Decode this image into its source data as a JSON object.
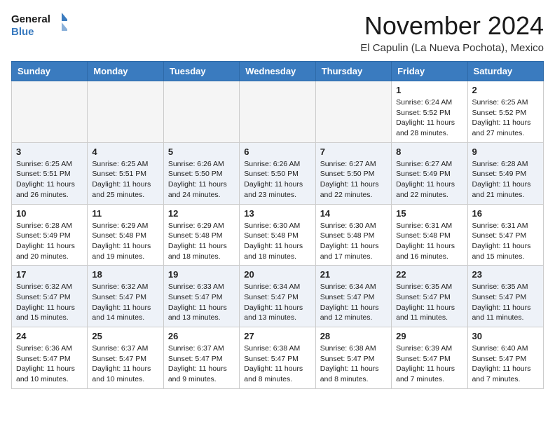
{
  "header": {
    "logo_line1": "General",
    "logo_line2": "Blue",
    "month": "November 2024",
    "location": "El Capulin (La Nueva Pochota), Mexico"
  },
  "weekdays": [
    "Sunday",
    "Monday",
    "Tuesday",
    "Wednesday",
    "Thursday",
    "Friday",
    "Saturday"
  ],
  "weeks": [
    [
      {
        "day": "",
        "empty": true
      },
      {
        "day": "",
        "empty": true
      },
      {
        "day": "",
        "empty": true
      },
      {
        "day": "",
        "empty": true
      },
      {
        "day": "",
        "empty": true
      },
      {
        "day": "1",
        "sunrise": "6:24 AM",
        "sunset": "5:52 PM",
        "daylight": "11 hours and 28 minutes."
      },
      {
        "day": "2",
        "sunrise": "6:25 AM",
        "sunset": "5:52 PM",
        "daylight": "11 hours and 27 minutes."
      }
    ],
    [
      {
        "day": "3",
        "sunrise": "6:25 AM",
        "sunset": "5:51 PM",
        "daylight": "11 hours and 26 minutes."
      },
      {
        "day": "4",
        "sunrise": "6:25 AM",
        "sunset": "5:51 PM",
        "daylight": "11 hours and 25 minutes."
      },
      {
        "day": "5",
        "sunrise": "6:26 AM",
        "sunset": "5:50 PM",
        "daylight": "11 hours and 24 minutes."
      },
      {
        "day": "6",
        "sunrise": "6:26 AM",
        "sunset": "5:50 PM",
        "daylight": "11 hours and 23 minutes."
      },
      {
        "day": "7",
        "sunrise": "6:27 AM",
        "sunset": "5:50 PM",
        "daylight": "11 hours and 22 minutes."
      },
      {
        "day": "8",
        "sunrise": "6:27 AM",
        "sunset": "5:49 PM",
        "daylight": "11 hours and 22 minutes."
      },
      {
        "day": "9",
        "sunrise": "6:28 AM",
        "sunset": "5:49 PM",
        "daylight": "11 hours and 21 minutes."
      }
    ],
    [
      {
        "day": "10",
        "sunrise": "6:28 AM",
        "sunset": "5:49 PM",
        "daylight": "11 hours and 20 minutes."
      },
      {
        "day": "11",
        "sunrise": "6:29 AM",
        "sunset": "5:48 PM",
        "daylight": "11 hours and 19 minutes."
      },
      {
        "day": "12",
        "sunrise": "6:29 AM",
        "sunset": "5:48 PM",
        "daylight": "11 hours and 18 minutes."
      },
      {
        "day": "13",
        "sunrise": "6:30 AM",
        "sunset": "5:48 PM",
        "daylight": "11 hours and 18 minutes."
      },
      {
        "day": "14",
        "sunrise": "6:30 AM",
        "sunset": "5:48 PM",
        "daylight": "11 hours and 17 minutes."
      },
      {
        "day": "15",
        "sunrise": "6:31 AM",
        "sunset": "5:48 PM",
        "daylight": "11 hours and 16 minutes."
      },
      {
        "day": "16",
        "sunrise": "6:31 AM",
        "sunset": "5:47 PM",
        "daylight": "11 hours and 15 minutes."
      }
    ],
    [
      {
        "day": "17",
        "sunrise": "6:32 AM",
        "sunset": "5:47 PM",
        "daylight": "11 hours and 15 minutes."
      },
      {
        "day": "18",
        "sunrise": "6:32 AM",
        "sunset": "5:47 PM",
        "daylight": "11 hours and 14 minutes."
      },
      {
        "day": "19",
        "sunrise": "6:33 AM",
        "sunset": "5:47 PM",
        "daylight": "11 hours and 13 minutes."
      },
      {
        "day": "20",
        "sunrise": "6:34 AM",
        "sunset": "5:47 PM",
        "daylight": "11 hours and 13 minutes."
      },
      {
        "day": "21",
        "sunrise": "6:34 AM",
        "sunset": "5:47 PM",
        "daylight": "11 hours and 12 minutes."
      },
      {
        "day": "22",
        "sunrise": "6:35 AM",
        "sunset": "5:47 PM",
        "daylight": "11 hours and 11 minutes."
      },
      {
        "day": "23",
        "sunrise": "6:35 AM",
        "sunset": "5:47 PM",
        "daylight": "11 hours and 11 minutes."
      }
    ],
    [
      {
        "day": "24",
        "sunrise": "6:36 AM",
        "sunset": "5:47 PM",
        "daylight": "11 hours and 10 minutes."
      },
      {
        "day": "25",
        "sunrise": "6:37 AM",
        "sunset": "5:47 PM",
        "daylight": "11 hours and 10 minutes."
      },
      {
        "day": "26",
        "sunrise": "6:37 AM",
        "sunset": "5:47 PM",
        "daylight": "11 hours and 9 minutes."
      },
      {
        "day": "27",
        "sunrise": "6:38 AM",
        "sunset": "5:47 PM",
        "daylight": "11 hours and 8 minutes."
      },
      {
        "day": "28",
        "sunrise": "6:38 AM",
        "sunset": "5:47 PM",
        "daylight": "11 hours and 8 minutes."
      },
      {
        "day": "29",
        "sunrise": "6:39 AM",
        "sunset": "5:47 PM",
        "daylight": "11 hours and 7 minutes."
      },
      {
        "day": "30",
        "sunrise": "6:40 AM",
        "sunset": "5:47 PM",
        "daylight": "11 hours and 7 minutes."
      }
    ]
  ]
}
